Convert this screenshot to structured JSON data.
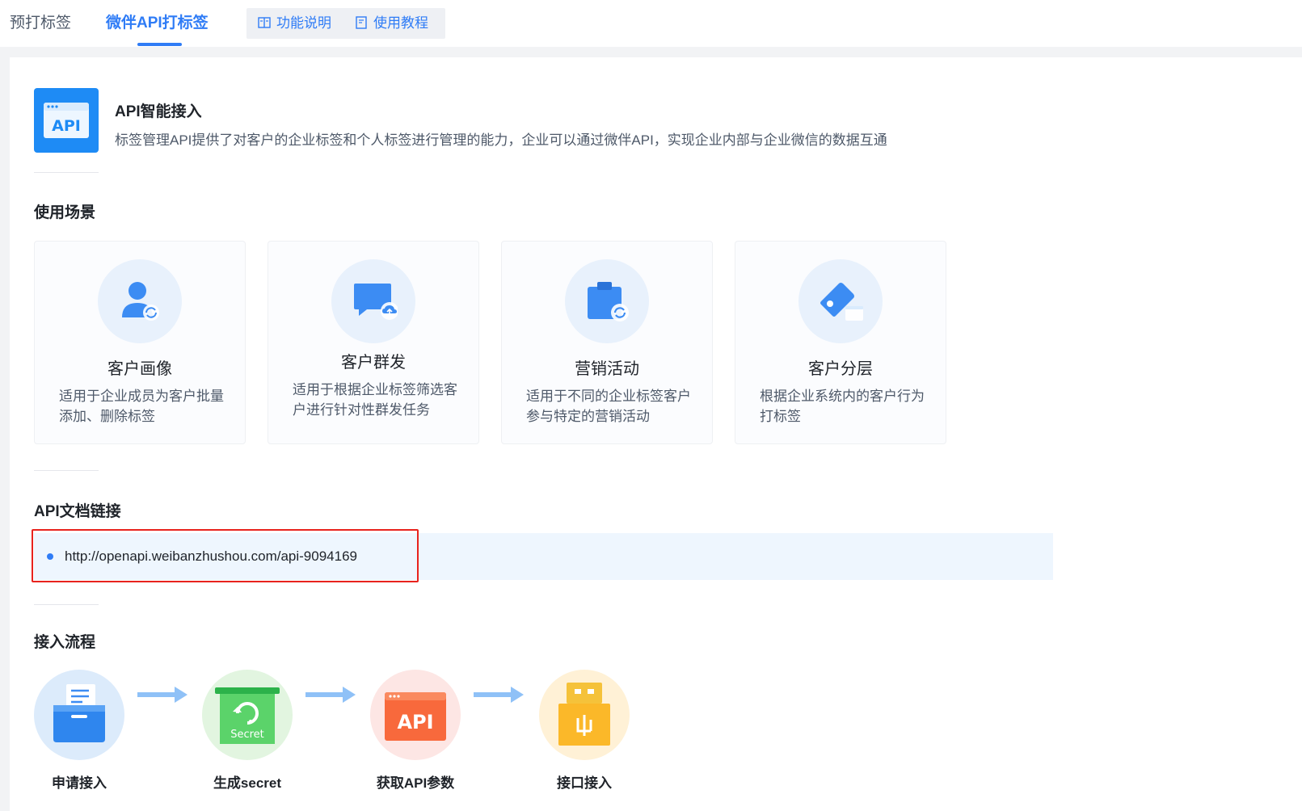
{
  "tabs": {
    "pre_tag": "预打标签",
    "api_tag": "微伴API打标签",
    "feature_desc": "功能说明",
    "tutorial": "使用教程"
  },
  "intro": {
    "logo_text": "API",
    "title": "API智能接入",
    "description": "标签管理API提供了对客户的企业标签和个人标签进行管理的能力，企业可以通过微伴API，实现企业内部与企业微信的数据互通"
  },
  "scenarios": {
    "title": "使用场景",
    "items": [
      {
        "title": "客户画像",
        "desc": "适用于企业成员为客户批量添加、删除标签",
        "icon": "user-sync-icon"
      },
      {
        "title": "客户群发",
        "desc": "适用于根据企业标签筛选客户进行针对性群发任务",
        "icon": "message-upload-icon"
      },
      {
        "title": "营销活动",
        "desc": "适用于不同的企业标签客户参与特定的营销活动",
        "icon": "clipboard-refresh-icon"
      },
      {
        "title": "客户分层",
        "desc": "根据企业系统内的客户行为打标签",
        "icon": "tag-card-icon"
      }
    ]
  },
  "api_doc": {
    "title": "API文档链接",
    "url": "http://openapi.weibanzhushou.com/api-9094169"
  },
  "process": {
    "title": "接入流程",
    "steps": [
      {
        "label": "申请接入",
        "icon": "folder-document-icon"
      },
      {
        "label": "生成secret",
        "icon": "secret-box-icon",
        "badge": "Secret"
      },
      {
        "label": "获取API参数",
        "icon": "api-window-icon",
        "badge": "API"
      },
      {
        "label": "接口接入",
        "icon": "usb-plug-icon"
      }
    ]
  },
  "colors": {
    "accent": "#2f7cf6",
    "highlight_border": "#e8231d",
    "link_bg": "#eef6fe"
  }
}
